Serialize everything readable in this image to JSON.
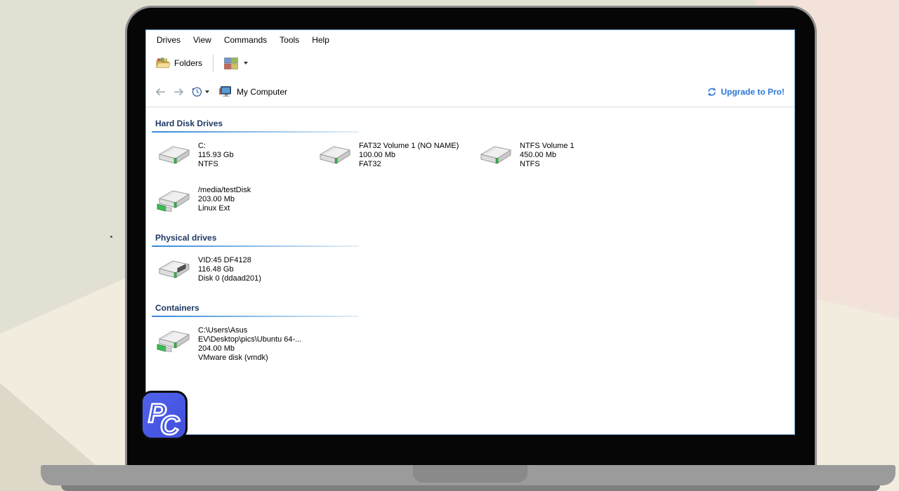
{
  "app": {
    "menu": [
      "Drives",
      "View",
      "Commands",
      "Tools",
      "Help"
    ],
    "toolbar": {
      "folders_label": "Folders",
      "folders_icon": "folders-icon",
      "views_icon": "view-options-icon"
    },
    "nav": {
      "back_icon": "back-arrow-icon",
      "forward_icon": "forward-arrow-icon",
      "history_icon": "history-icon",
      "computer_icon": "my-computer-icon",
      "location": "My Computer",
      "upgrade_icon": "refresh-icon",
      "upgrade_label": "Upgrade to Pro!"
    },
    "colors": {
      "link_blue": "#2a77d6",
      "section_header_navy": "#1f3864",
      "underline_blue": "#3388d6",
      "window_border_blue": "#74a7d7"
    },
    "sections": [
      {
        "title": "Hard Disk Drives",
        "items": [
          {
            "icon": "hard-disk-icon",
            "lines": [
              "C:",
              "115.93 Gb",
              "NTFS"
            ]
          },
          {
            "icon": "hard-disk-icon",
            "lines": [
              "FAT32 Volume 1 (NO NAME)",
              "100.00 Mb",
              "FAT32"
            ]
          },
          {
            "icon": "hard-disk-icon",
            "lines": [
              "NTFS Volume 1",
              "450.00 Mb",
              "NTFS"
            ]
          },
          {
            "icon": "mounted-disk-icon",
            "lines": [
              "/media/testDisk",
              "203.00 Mb",
              "Linux Ext"
            ]
          }
        ]
      },
      {
        "title": "Physical drives",
        "items": [
          {
            "icon": "physical-disk-icon",
            "lines": [
              "VID:45 DF4128",
              "116.48 Gb",
              "Disk 0 (ddaad201)"
            ]
          }
        ]
      },
      {
        "title": "Containers",
        "items": [
          {
            "icon": "mounted-disk-icon",
            "lines": [
              "C:\\Users\\Asus",
              "EV\\Desktop\\pics\\Ubuntu 64-...",
              "204.00 Mb",
              "VMware disk (vmdk)"
            ]
          }
        ]
      }
    ]
  },
  "logo": {
    "text": "PC"
  }
}
